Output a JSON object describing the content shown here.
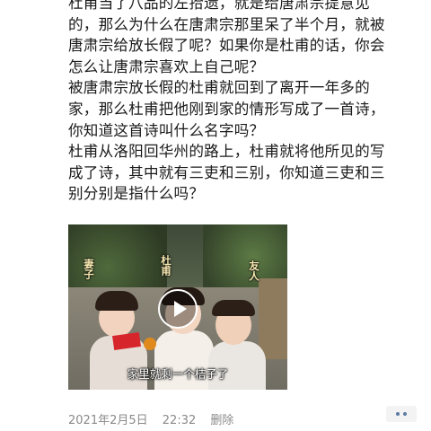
{
  "post": {
    "lines": [
      "杜甫当了八品的左拾遗，就是给唐肃宗提意见",
      "的，那么为什么在唐肃宗那里呆了半个月，就被",
      "唐肃宗给放长假了呢？如果你是杜甫的话，你会",
      "怎么让唐肃宗喜欢上自己呢？",
      "被唐肃宗放长假的杜甫就回到了离开一年多的",
      "家，那么杜甫把他刚到家的情形写成了一首诗，",
      "你知道这首诗叫什么名字吗？",
      "杜甫从洛阳回华州的路上，杜甫就将他所见的写",
      "成了诗，其中就有三吏和三别，你知道三吏和三",
      "别分别是指什么吗？"
    ]
  },
  "video": {
    "label_wife": "妻子",
    "label_dufu": "杜甫",
    "label_friend": "友人",
    "subtitle": "家里就剩一个桔子了",
    "play_icon": "play-icon"
  },
  "meta": {
    "date": "2021年2月5日",
    "time": "22:32",
    "delete_label": "删除",
    "more_icon": "more-dots-icon",
    "accent_color": "#5d7aa3"
  }
}
